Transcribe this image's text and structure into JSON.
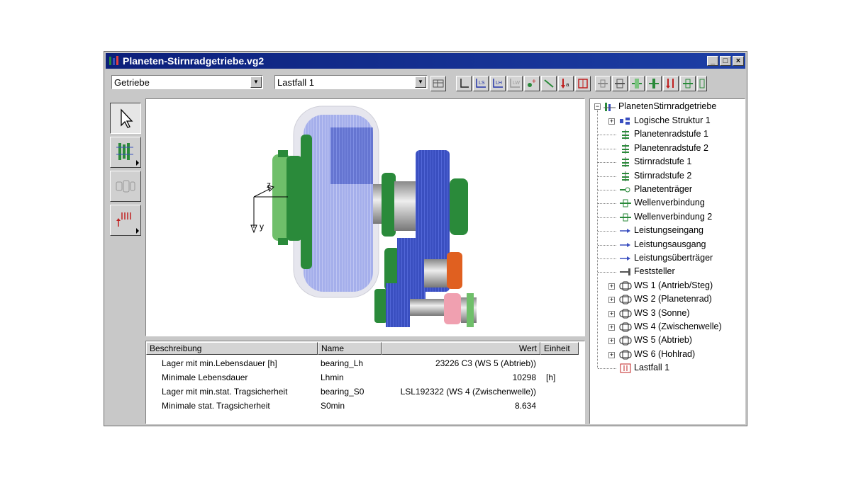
{
  "window": {
    "title": "Planeten-Stirnradgetriebe.vg2",
    "buttons": {
      "minimize": "_",
      "maximize": "□",
      "close": "×"
    }
  },
  "toolbar": {
    "combo_left": "Getriebe",
    "combo_right": "Lastfall 1",
    "tb_labels": [
      "LS",
      "LH",
      "LW"
    ]
  },
  "palette": {
    "items": [
      "select-tool",
      "gear-stage-tool",
      "shaft-tool",
      "load-tool"
    ]
  },
  "view3d": {
    "axis_z": "z",
    "axis_y": "y"
  },
  "table": {
    "headers": {
      "beschreibung": "Beschreibung",
      "name": "Name",
      "wert": "Wert",
      "einheit": "Einheit"
    },
    "rows": [
      {
        "beschreibung": "Lager mit min.Lebensdauer [h]",
        "name": "bearing_Lh",
        "wert": "23226 C3 (WS 5 (Abtrieb))",
        "einheit": ""
      },
      {
        "beschreibung": "Minimale Lebensdauer",
        "name": "Lhmin",
        "wert": "10298",
        "einheit": "[h]"
      },
      {
        "beschreibung": "Lager mit min.stat. Tragsicherheit",
        "name": "bearing_S0",
        "wert": "LSL192322 (WS 4 (Zwischenwelle))",
        "einheit": ""
      },
      {
        "beschreibung": "Minimale stat. Tragsicherheit",
        "name": "S0min",
        "wert": "8.634",
        "einheit": ""
      }
    ]
  },
  "tree": {
    "root": "PlanetenStirnradgetriebe",
    "items": [
      {
        "label": "Logische Struktur 1",
        "expandable": true
      },
      {
        "label": "Planetenradstufe 1",
        "expandable": false
      },
      {
        "label": "Planetenradstufe 2",
        "expandable": false
      },
      {
        "label": "Stirnradstufe 1",
        "expandable": false
      },
      {
        "label": "Stirnradstufe 2",
        "expandable": false
      },
      {
        "label": "Planetenträger",
        "expandable": false
      },
      {
        "label": "Wellenverbindung",
        "expandable": false
      },
      {
        "label": "Wellenverbindung 2",
        "expandable": false
      },
      {
        "label": "Leistungseingang",
        "expandable": false
      },
      {
        "label": "Leistungsausgang",
        "expandable": false
      },
      {
        "label": "Leistungsüberträger",
        "expandable": false
      },
      {
        "label": "Feststeller",
        "expandable": false
      },
      {
        "label": "WS 1 (Antrieb/Steg)",
        "expandable": true
      },
      {
        "label": "WS 2 (Planetenrad)",
        "expandable": true
      },
      {
        "label": "WS 3 (Sonne)",
        "expandable": true
      },
      {
        "label": "WS 4 (Zwischenwelle)",
        "expandable": true
      },
      {
        "label": "WS 5 (Abtrieb)",
        "expandable": true
      },
      {
        "label": "WS 6 (Hohlrad)",
        "expandable": true
      },
      {
        "label": "Lastfall 1",
        "expandable": false
      }
    ]
  },
  "colors": {
    "titlebar": "#0b1f7a",
    "gear_blue": "#3a4fc0",
    "gear_green": "#2a8a3a",
    "gear_orange": "#e06020",
    "gear_pink": "#f0a0b0"
  }
}
